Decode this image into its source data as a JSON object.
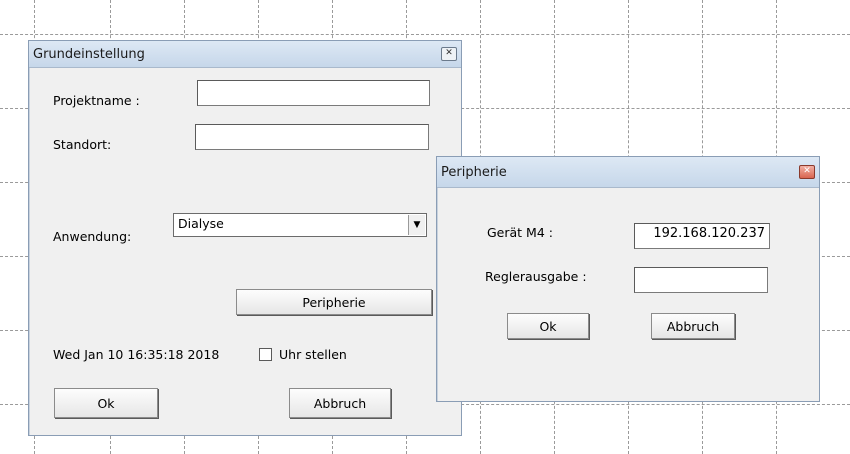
{
  "grundeinstellung": {
    "title": "Grundeinstellung",
    "close_icon": "close-icon",
    "projektname_label": "Projektname :",
    "projektname_value": "",
    "standort_label": "Standort:",
    "standort_value": "",
    "anwendung_label": "Anwendung:",
    "anwendung_value": "Dialyse",
    "peripherie_button": "Peripherie",
    "datetime": "Wed Jan 10 16:35:18 2018",
    "uhr_stellen_label": "Uhr stellen",
    "uhr_stellen_checked": false,
    "ok_button": "Ok",
    "abbruch_button": "Abbruch"
  },
  "peripherie": {
    "title": "Peripherie",
    "close_icon": "close-icon",
    "geraet_label": "Gerät M4 :",
    "geraet_value": "192.168.120.237",
    "regler_label": "Reglerausgabe :",
    "regler_value": "",
    "ok_button": "Ok",
    "abbruch_button": "Abbruch"
  }
}
